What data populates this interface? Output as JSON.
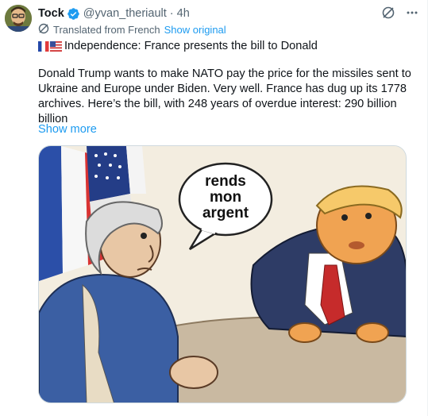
{
  "author": {
    "name": "Tock",
    "handle": "@yvan_theriault",
    "separator": "·",
    "time": "4h"
  },
  "translation": {
    "label": "Translated from French",
    "show_original": "Show original"
  },
  "tweet": {
    "headline": "Independence: France presents the bill to Donald",
    "paragraph": "Donald Trump wants to make NATO pay the price for the missiles sent to Ukraine and Europe under Biden. Very well. France has dug up its 1778 archives. Here’s the bill, with 248 years of overdue interest: 290 billion billion",
    "show_more": "Show more"
  },
  "media": {
    "speech_bubble": [
      "rends",
      "mon",
      "argent"
    ]
  },
  "icons": {
    "verified": "verified-badge-icon",
    "grok": "grok-icon",
    "more": "more-icon",
    "translate": "translate-icon",
    "flags": [
      "france-flag-icon",
      "usa-flag-icon"
    ]
  },
  "colors": {
    "accent": "#1d9bf0",
    "secondary_text": "#536471",
    "primary_text": "#0f1419"
  }
}
